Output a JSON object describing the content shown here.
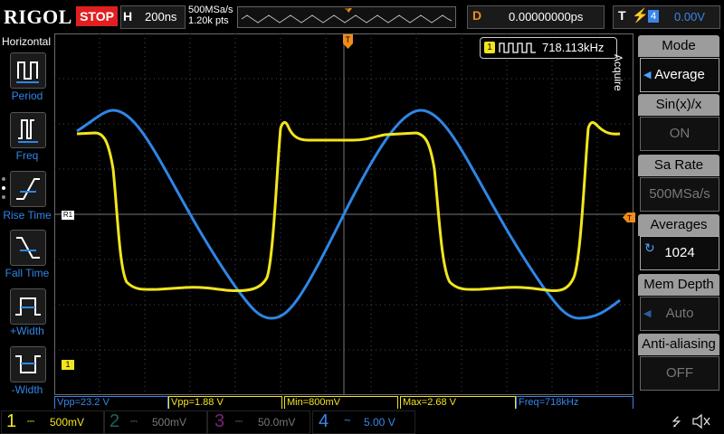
{
  "topbar": {
    "logo": "RIGOL",
    "run_state": "STOP",
    "h_label": "H",
    "timebase": "200ns",
    "sample_rate": "500MSa/s",
    "points": "1.20k pts",
    "delay_label": "D",
    "delay": "0.00000000ps",
    "trigger_label": "T",
    "trigger_source": "4",
    "trigger_level": "0.00V"
  },
  "left_menu": {
    "title": "Horizontal",
    "items": [
      {
        "label": "Period",
        "icon": "period-icon"
      },
      {
        "label": "Freq",
        "icon": "frequency-icon"
      },
      {
        "label": "Rise Time",
        "icon": "rise-time-icon"
      },
      {
        "label": "Fall Time",
        "icon": "fall-time-icon"
      },
      {
        "label": "+Width",
        "icon": "positive-width-icon"
      },
      {
        "label": "-Width",
        "icon": "negative-width-icon"
      }
    ]
  },
  "right_menu": {
    "side_label": "Acquire",
    "items": [
      {
        "title": "Mode",
        "value": "Average"
      },
      {
        "title": "Sin(x)/x",
        "value": "ON"
      },
      {
        "title": "Sa Rate",
        "value": "500MSa/s"
      },
      {
        "title": "Averages",
        "value": "1024"
      },
      {
        "title": "Mem Depth",
        "value": "Auto"
      },
      {
        "title": "Anti-aliasing",
        "value": "OFF"
      }
    ]
  },
  "screen": {
    "freq_counter_channel": "1",
    "freq_counter": "718.113kHz",
    "ref_marker": "R1",
    "ch1_marker": "1",
    "trigger_marker": "T"
  },
  "measurements": [
    {
      "text": "Vpp=23.2 V",
      "color": "#3a86e8"
    },
    {
      "text": "Vpp=1.88 V",
      "color": "#f2e51d"
    },
    {
      "text": "Min=800mV",
      "color": "#f2e51d"
    },
    {
      "text": "Max=2.68 V",
      "color": "#f2e51d"
    },
    {
      "text": "Freq=718kHz",
      "color": "#3a86e8"
    }
  ],
  "channels": [
    {
      "num": "1",
      "coupling": "⎓",
      "scale": "500mV",
      "color": "#f2e51d",
      "active": true
    },
    {
      "num": "2",
      "coupling": "⎓",
      "scale": "500mV",
      "color": "#2fb9a8",
      "active": false
    },
    {
      "num": "3",
      "coupling": "⎓",
      "scale": "50.0mV",
      "color": "#c23fc6",
      "active": false
    },
    {
      "num": "4",
      "coupling": "~",
      "scale": "5.00 V",
      "color": "#3a86e8",
      "active": true
    }
  ],
  "colors": {
    "ch1": "#f2e51d",
    "ch4": "#3a86e8",
    "trigger": "#f08c1a",
    "stop": "#e02020"
  }
}
